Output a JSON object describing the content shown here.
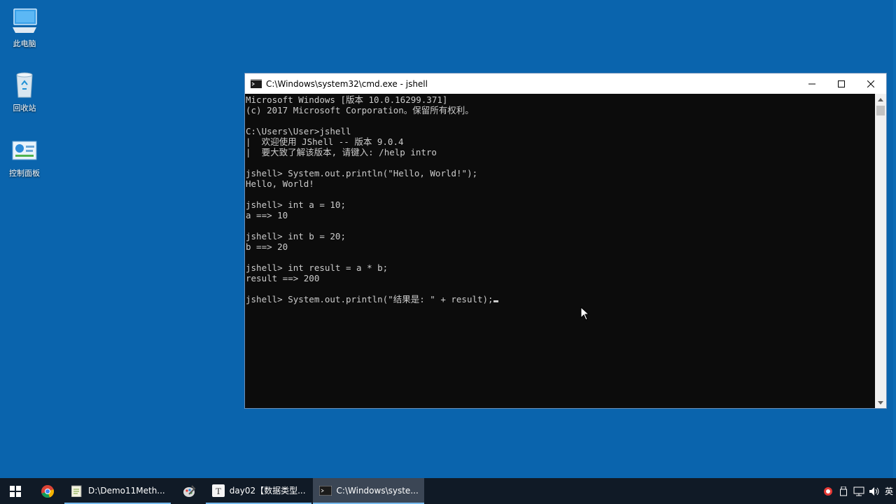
{
  "desktop": {
    "icons": [
      {
        "label": "此电脑",
        "icon": "this-pc-icon"
      },
      {
        "label": "回收站",
        "icon": "recycle-bin-icon"
      },
      {
        "label": "控制面板",
        "icon": "control-panel-icon"
      }
    ]
  },
  "cmd": {
    "title": "C:\\Windows\\system32\\cmd.exe - jshell",
    "lines": [
      "Microsoft Windows [版本 10.0.16299.371]",
      "(c) 2017 Microsoft Corporation。保留所有权利。",
      "",
      "C:\\Users\\User>jshell",
      "|  欢迎使用 JShell -- 版本 9.0.4",
      "|  要大致了解该版本, 请键入: /help intro",
      "",
      "jshell> System.out.println(\"Hello, World!\");",
      "Hello, World!",
      "",
      "jshell> int a = 10;",
      "a ==> 10",
      "",
      "jshell> int b = 20;",
      "b ==> 20",
      "",
      "jshell> int result = a * b;",
      "result ==> 200",
      "",
      "jshell> System.out.println(\"结果是: \" + result);"
    ],
    "colors": {
      "background": "#0c0c0c",
      "text": "#cccccc"
    }
  },
  "taskbar": {
    "apps": [
      {
        "label": "D:\\Demo11Meth...",
        "icon": "notepad-icon",
        "active": false
      },
      {
        "label": "day02【数据类型...",
        "icon": "typora-icon",
        "active": false
      },
      {
        "label": "C:\\Windows\\syste...",
        "icon": "cmd-icon",
        "active": true
      }
    ],
    "tray": {
      "ime": "英"
    }
  },
  "colors": {
    "desktop": "#0a64ad",
    "taskbar": "#101a26",
    "accent": "#76b9ed"
  }
}
